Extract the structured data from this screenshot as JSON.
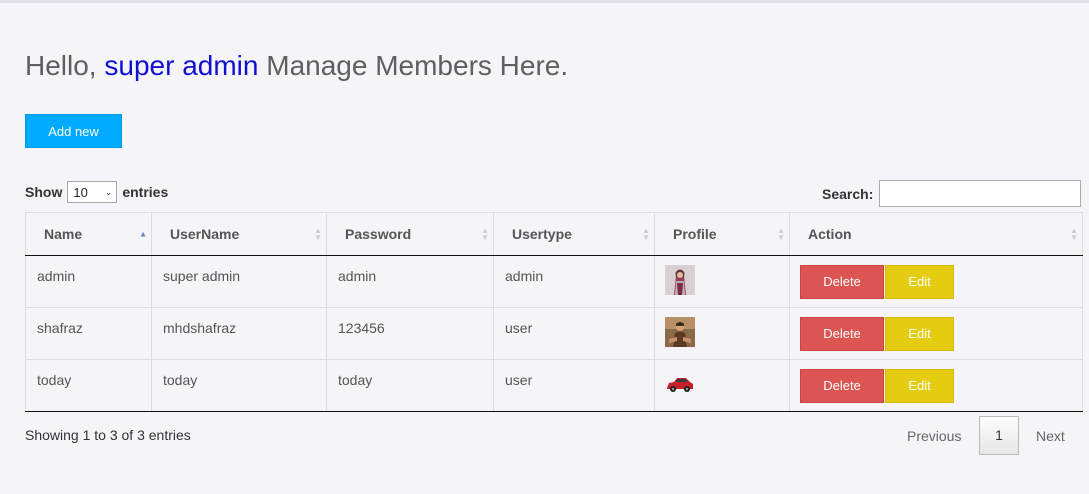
{
  "header": {
    "hello": "Hello,",
    "user_name": "super admin",
    "rest": "Manage Members Here."
  },
  "add_button_label": "Add new",
  "length_menu": {
    "show_label": "Show",
    "selected": "10",
    "entries_label": "entries"
  },
  "search": {
    "label": "Search:",
    "value": ""
  },
  "table": {
    "columns": [
      "Name",
      "UserName",
      "Password",
      "Usertype",
      "Profile",
      "Action"
    ],
    "sorted_column": "Name",
    "rows": [
      {
        "name": "admin",
        "username": "super admin",
        "password": "admin",
        "usertype": "admin",
        "profile": "avatar-woman-icon"
      },
      {
        "name": "shafraz",
        "username": "mhdshafraz",
        "password": "123456",
        "usertype": "user",
        "profile": "avatar-man-icon"
      },
      {
        "name": "today",
        "username": "today",
        "password": "today",
        "usertype": "user",
        "profile": "car-icon"
      }
    ],
    "delete_label": "Delete",
    "edit_label": "Edit"
  },
  "info_text": "Showing 1 to 3 of 3 entries",
  "pagination": {
    "previous": "Previous",
    "current_page": "1",
    "next": "Next"
  },
  "colors": {
    "background": "#f4f4f9",
    "accent_blue": "#00aaff",
    "user_name": "#1010d0",
    "delete": "#dd5552",
    "edit": "#e5cc10"
  }
}
